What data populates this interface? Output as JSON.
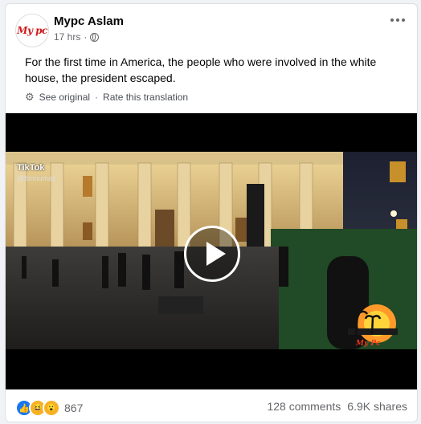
{
  "post": {
    "author": "Mypc Aslam",
    "avatar_logo": "My pc",
    "time": "17 hrs",
    "text": "For the first time in America, the people who were involved in the white house, the president escaped.",
    "see_original": "See original",
    "rate_translation": "Rate this translation",
    "separator": "·"
  },
  "video": {
    "tiktok_label": "TikTok",
    "tiktok_user": "@tbnnumaz",
    "watermark_text": "My Pc"
  },
  "footer": {
    "reaction_count": "867",
    "comments": "128 comments",
    "shares": "6.9K shares"
  },
  "colors": {
    "like": "#1877f2",
    "reaction_yellow": "#f7b125",
    "meta_gray": "#65676b"
  }
}
